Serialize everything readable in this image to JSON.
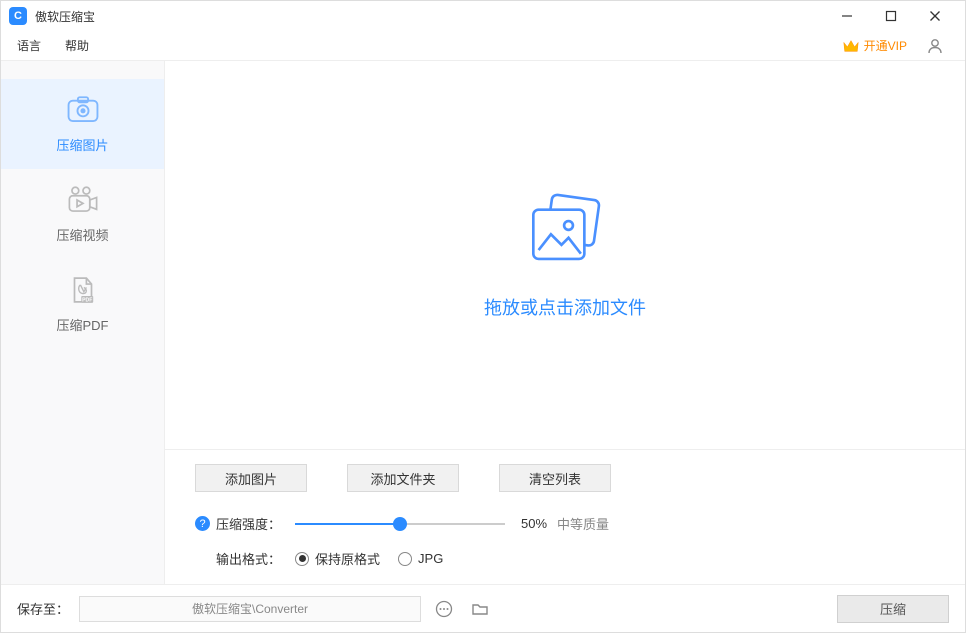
{
  "app": {
    "title": "傲软压缩宝"
  },
  "menubar": {
    "lang": "语言",
    "help": "帮助",
    "vip": "开通VIP"
  },
  "sidebar": {
    "items": [
      {
        "label": "压缩图片"
      },
      {
        "label": "压缩视频"
      },
      {
        "label": "压缩PDF"
      }
    ]
  },
  "dropzone": {
    "text": "拖放或点击添加文件"
  },
  "buttons": {
    "add_image": "添加图片",
    "add_folder": "添加文件夹",
    "clear_list": "清空列表"
  },
  "compress": {
    "strength_label": "压缩强度：",
    "percent": "50%",
    "quality": "中等质量",
    "output_label": "输出格式：",
    "keep_format": "保持原格式",
    "jpg": "JPG"
  },
  "footer": {
    "save_to": "保存至：",
    "path": "傲软压缩宝\\Converter",
    "compress_btn": "压缩"
  }
}
